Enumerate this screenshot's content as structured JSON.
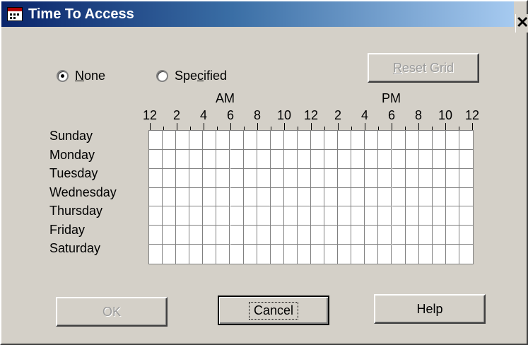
{
  "window": {
    "title": "Time To Access",
    "close_glyph": "✕",
    "icon": "app-window-icon"
  },
  "options": {
    "none": {
      "label_accel": "N",
      "label_rest": "one",
      "selected": true
    },
    "specified": {
      "label_pre": "Spe",
      "label_accel": "c",
      "label_rest": "ified",
      "selected": false
    }
  },
  "reset_button": {
    "accel": "R",
    "rest": "eset Grid",
    "disabled": true
  },
  "axis": {
    "am_label": "AM",
    "pm_label": "PM",
    "tick_labels": [
      "12",
      "2",
      "4",
      "6",
      "8",
      "10",
      "12",
      "2",
      "4",
      "6",
      "8",
      "10",
      "12"
    ]
  },
  "days": [
    "Sunday",
    "Monday",
    "Tuesday",
    "Wednesday",
    "Thursday",
    "Friday",
    "Saturday"
  ],
  "grid": {
    "hours": 24,
    "rows": 7,
    "selected_cells": []
  },
  "buttons": {
    "ok": {
      "label": "OK",
      "disabled": true
    },
    "cancel": {
      "label": "Cancel",
      "default": true
    },
    "help": {
      "label": "Help"
    }
  },
  "colors": {
    "title_start": "#0a246a",
    "title_end": "#a6caf0",
    "face": "#d4d0c8",
    "grid_line": "#808080"
  }
}
